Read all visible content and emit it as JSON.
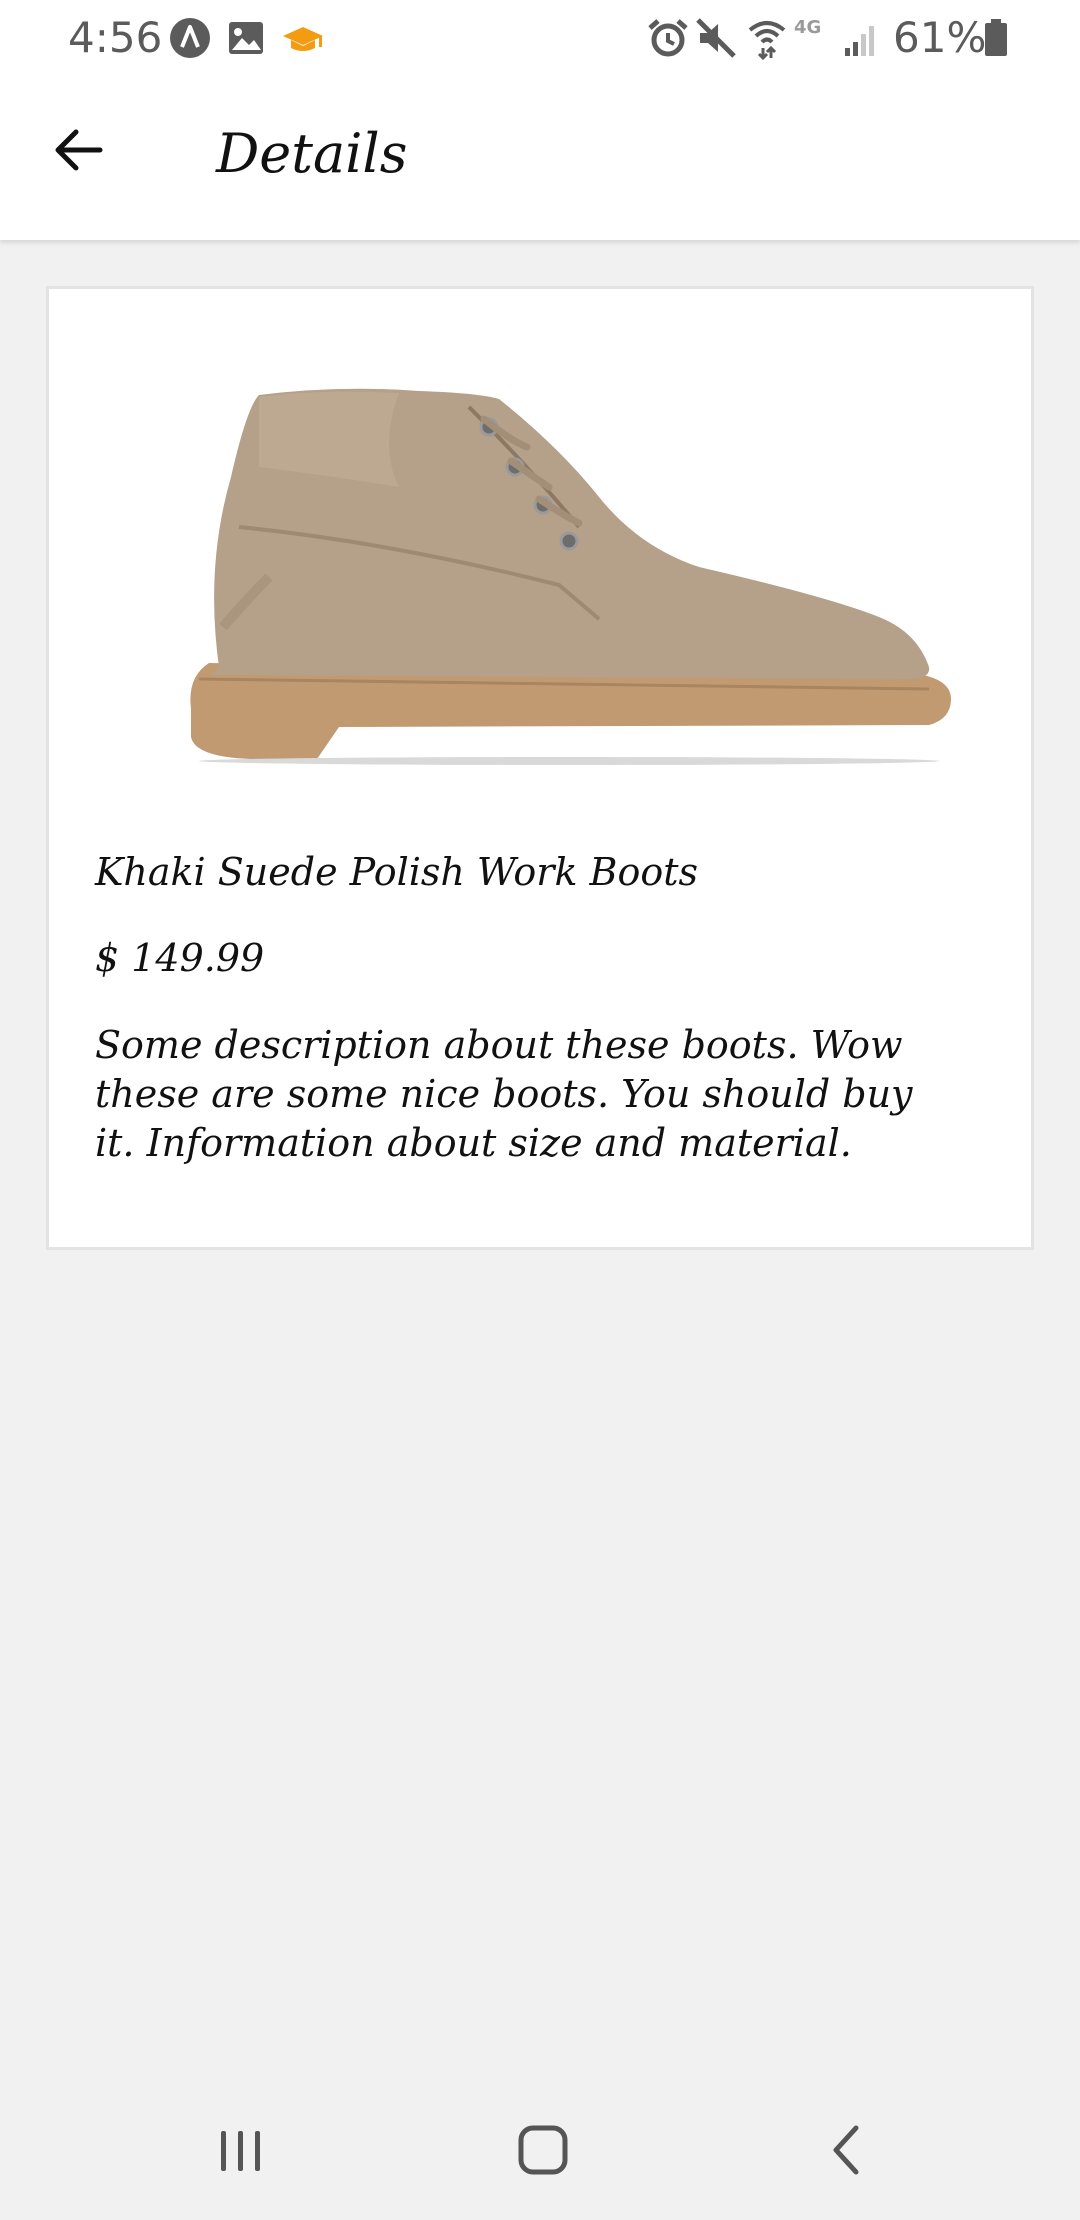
{
  "status_bar": {
    "time": "4:56",
    "battery_percent": "61%",
    "network_label": "4G",
    "icons": [
      "autonomous-a-icon",
      "image-icon",
      "graduation-cap-icon",
      "alarm-icon",
      "mute-icon",
      "wifi-calling-icon",
      "signal-icon",
      "battery-icon"
    ]
  },
  "app_bar": {
    "title": "Details",
    "back_icon": "arrow-back-icon"
  },
  "product": {
    "name": "Khaki Suede Polish Work Boots",
    "price": "$ 149.99",
    "description": "Some description about these boots. Wow these are some nice boots. You should buy it. Information about size and material.",
    "image_alt": "khaki suede chukka boot"
  },
  "nav_bar": {
    "buttons": [
      "recents-icon",
      "home-icon",
      "back-icon"
    ]
  },
  "colors": {
    "background": "#f1f1f1",
    "surface": "#ffffff",
    "text": "#111111",
    "status_text": "#5b5b5b",
    "accent_cap": "#f39c12",
    "boot_suede": "#b5a08a",
    "boot_sole": "#c19a72"
  }
}
